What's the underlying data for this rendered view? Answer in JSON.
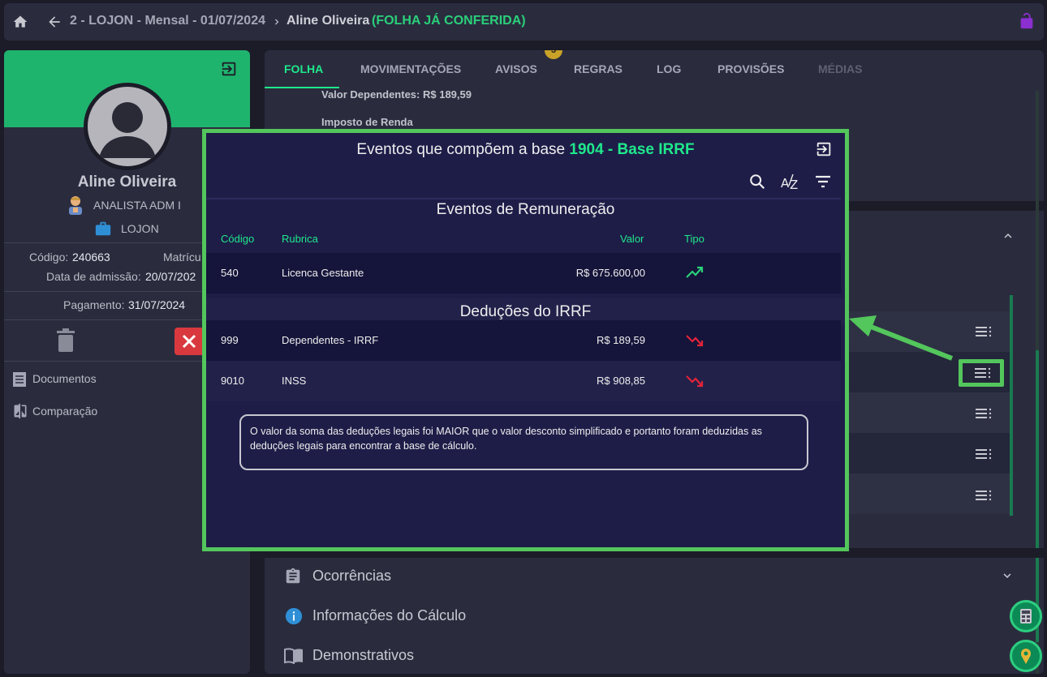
{
  "breadcrumb": {
    "company": "2 - LOJON - Mensal - 01/07/2024",
    "employee": "Aline Oliveira",
    "status": "(FOLHA JÁ CONFERIDA)"
  },
  "colors": {
    "accent_green": "#1fe88b",
    "badge_yellow": "#c9a227",
    "danger_red": "#d9393e",
    "lock_purple": "#8c2fd0"
  },
  "icons": [
    "home-icon",
    "back-arrow-icon",
    "chevron-right-icon",
    "lock-icon",
    "exit-icon",
    "trash-icon",
    "close-icon",
    "document-icon",
    "compare-icon",
    "search-icon",
    "sort-az-icon",
    "filter-icon",
    "trend-up-icon",
    "trend-down-icon",
    "menu-lines-icon",
    "clipboard-icon",
    "info-icon",
    "book-icon",
    "chevron-down-icon",
    "chevron-up-icon"
  ],
  "profile": {
    "name": "Aline Oliveira",
    "role": "ANALISTA ADM I",
    "company": "LOJON",
    "code_label": "Código:",
    "code": "240663",
    "registration_label": "Matrícu",
    "admission_label": "Data de admissão:",
    "admission": "20/07/202",
    "payment_label": "Pagamento:",
    "payment": "31/07/2024"
  },
  "left_menu": [
    {
      "label": "Documentos"
    },
    {
      "label": "Comparação"
    }
  ],
  "tabs": [
    {
      "label": "FOLHA"
    },
    {
      "label": "MOVIMENTAÇÕES"
    },
    {
      "label": "AVISOS",
      "badge": "3"
    },
    {
      "label": "REGRAS"
    },
    {
      "label": "LOG"
    },
    {
      "label": "PROVISÕES"
    },
    {
      "label": "MÉDIAS"
    }
  ],
  "folha": {
    "dependents_value": "Valor Dependentes: R$ 189,59",
    "income_tax": "Imposto de Renda"
  },
  "sections": [
    {
      "label": "Ocorrências"
    },
    {
      "label": "Informações do Cálculo"
    },
    {
      "label": "Demonstrativos"
    }
  ],
  "modal": {
    "title_prefix": "Eventos que compõem a base",
    "title_highlight": "1904 - Base IRRF",
    "remuneration_title": "Eventos de Remuneração",
    "deductions_title": "Deduções do IRRF",
    "columns": {
      "code": "Código",
      "rubric": "Rubrica",
      "value": "Valor",
      "type": "Tipo"
    },
    "remuneration_rows": [
      {
        "code": "540",
        "rubric": "Licenca Gestante",
        "value": "R$ 675.600,00",
        "type": "up"
      }
    ],
    "deduction_rows": [
      {
        "code": "999",
        "rubric": "Dependentes - IRRF",
        "value": "R$ 189,59",
        "type": "down"
      },
      {
        "code": "9010",
        "rubric": "INSS",
        "value": "R$ 908,85",
        "type": "down"
      }
    ],
    "note": "O valor da soma das deduções legais foi MAIOR que o valor desconto simplificado e portanto foram deduzidas as deduções legais para encontrar a base de cálculo."
  }
}
